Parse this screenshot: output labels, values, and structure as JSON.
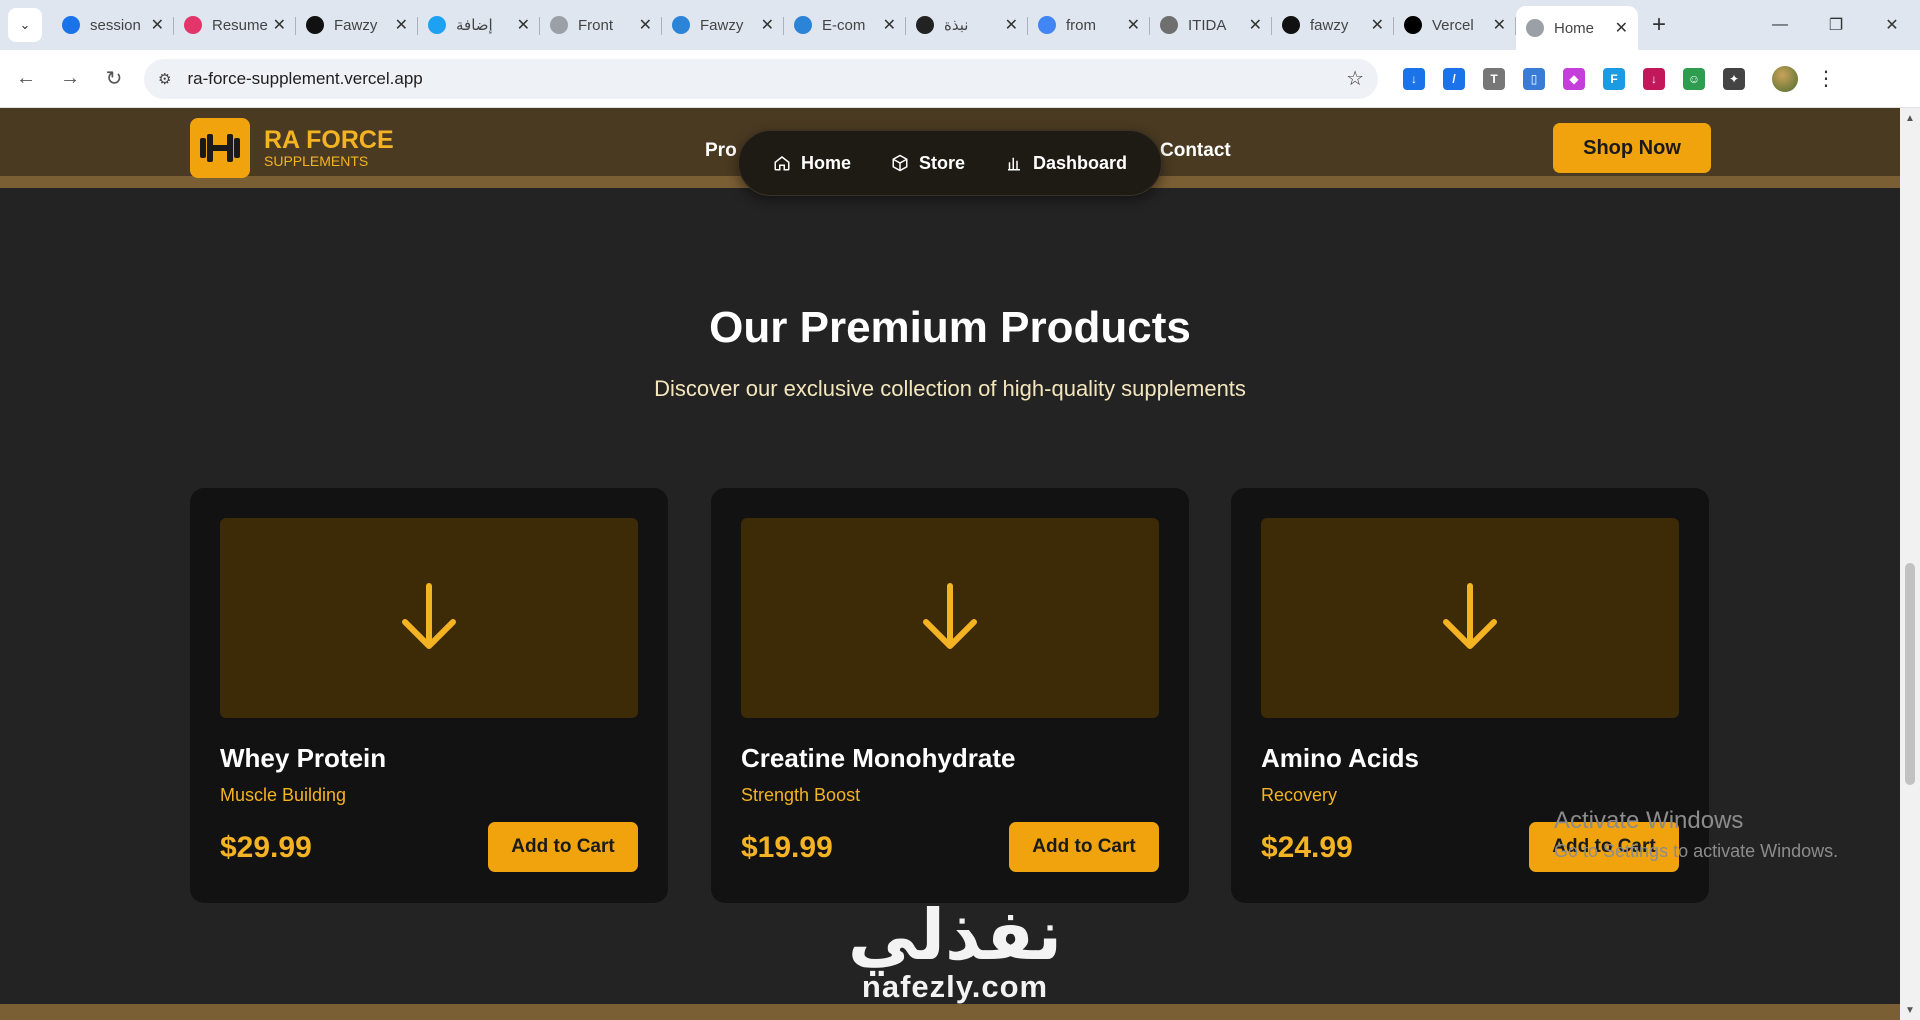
{
  "browser": {
    "tabs": [
      {
        "title": "session",
        "icon_color": "#1a73e8"
      },
      {
        "title": "Resume",
        "icon_color": "#e2356a"
      },
      {
        "title": "Fawzy",
        "icon_color": "#111111"
      },
      {
        "title": "إضافة",
        "icon_color": "#1da1f2"
      },
      {
        "title": "Front",
        "icon_color": "#9aa0a6"
      },
      {
        "title": "Fawzy",
        "icon_color": "#2b84d8"
      },
      {
        "title": "E-com",
        "icon_color": "#2b84d8"
      },
      {
        "title": "نبذة",
        "icon_color": "#222222"
      },
      {
        "title": "from",
        "icon_color": "#4285f4"
      },
      {
        "title": "ITIDA",
        "icon_color": "#6f6f6f"
      },
      {
        "title": "fawzy",
        "icon_color": "#111111"
      },
      {
        "title": "Vercel",
        "icon_color": "#000000"
      },
      {
        "title": "Home",
        "icon_color": "#9aa0a6"
      }
    ],
    "url": "ra-force-supplement.vercel.app",
    "extension_colors": [
      "#1a73e8",
      "#1a73e8",
      "#777777",
      "#3a7bd5",
      "#c43fd9",
      "#1a9be3",
      "#c2185b",
      "#2e9d4f",
      "#444444"
    ]
  },
  "header": {
    "brand_title": "RA FORCE",
    "brand_sub": "SUPPLEMENTS",
    "nav_partial_left": "Pro",
    "nav_contact": "Contact",
    "pill": {
      "home": "Home",
      "store": "Store",
      "dashboard": "Dashboard"
    },
    "cta": "Shop Now"
  },
  "section": {
    "title": "Our Premium Products",
    "subtitle": "Discover our exclusive collection of high-quality supplements"
  },
  "products": [
    {
      "name": "Whey Protein",
      "category": "Muscle Building",
      "price": "$29.99",
      "button": "Add to Cart"
    },
    {
      "name": "Creatine Monohydrate",
      "category": "Strength Boost",
      "price": "$19.99",
      "button": "Add to Cart"
    },
    {
      "name": "Amino Acids",
      "category": "Recovery",
      "price": "$24.99",
      "button": "Add to Cart"
    }
  ],
  "overlay": {
    "activate_title": "Activate Windows",
    "activate_sub": "Go to Settings to activate Windows.",
    "watermark_arabic": "نفذلي",
    "watermark_latin": "nafezly.com"
  },
  "colors": {
    "accent": "#f0a30d",
    "header_bg": "#4a3a22",
    "page_bg": "#232323",
    "card_bg": "#121212"
  }
}
